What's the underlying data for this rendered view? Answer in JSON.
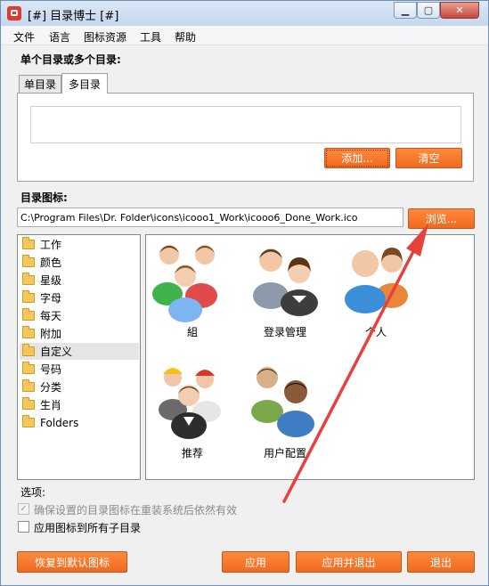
{
  "window": {
    "title": "[#] 目录博士 [#]"
  },
  "menu": [
    "文件",
    "语言",
    "图标资源",
    "工具",
    "帮助"
  ],
  "dir_section": {
    "label": "单个目录或多个目录:",
    "tabs": [
      "单目录",
      "多目录"
    ],
    "active_tab": "多目录",
    "add_label": "添加...",
    "clear_label": "清空"
  },
  "icon_section": {
    "label": "目录图标:",
    "path_value": "C:\\Program Files\\Dr. Folder\\icons\\icooo1_Work\\icooo6_Done_Work.ico",
    "browse_label": "浏览..."
  },
  "categories": [
    "工作",
    "颜色",
    "星级",
    "字母",
    "每天",
    "附加",
    "自定义",
    "号码",
    "分类",
    "生肖",
    "Folders"
  ],
  "selected_category": "自定义",
  "icons": [
    {
      "name": "group-icon",
      "label": "組"
    },
    {
      "name": "login-admin-icon",
      "label": "登录管理"
    },
    {
      "name": "personal-icon",
      "label": "个人"
    },
    {
      "name": "recommend-icon",
      "label": "推荐"
    },
    {
      "name": "user-config-icon",
      "label": "用户配置"
    }
  ],
  "options": {
    "label": "选项:",
    "items": [
      {
        "label": "确保设置的目录图标在重装系统后依然有效",
        "checked": true,
        "disabled": true
      },
      {
        "label": "应用图标到所有子目录",
        "checked": false,
        "disabled": false
      }
    ]
  },
  "footer": {
    "restore_label": "恢复到默认图标",
    "apply_label": "应用",
    "apply_exit_label": "应用并退出",
    "exit_label": "退出"
  },
  "colors": {
    "accent_button": "#ef6a1f",
    "annotation_arrow": "#e8403a",
    "titlebar": "#c4d7ee"
  }
}
